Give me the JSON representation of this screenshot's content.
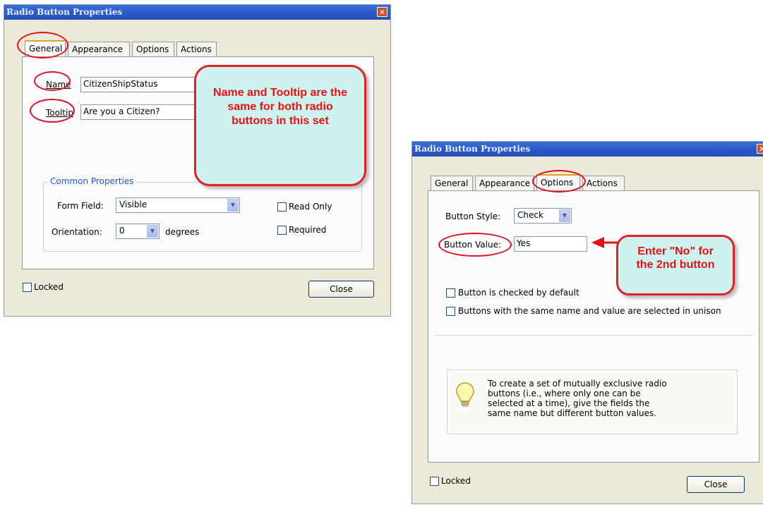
{
  "dialog1": {
    "title": "Radio Button Properties",
    "tabs": [
      "General",
      "Appearance",
      "Options",
      "Actions"
    ],
    "name_label": "Name",
    "name_value": "CitizenShipStatus",
    "tooltip_label": "Tooltip",
    "tooltip_value": "Are you a Citizen?",
    "group_title": "Common Properties",
    "form_field_label": "Form Field:",
    "form_field_value": "Visible",
    "orientation_label": "Orientation:",
    "orientation_value": "0",
    "degrees_label": "degrees",
    "read_only_label": "Read Only",
    "required_label": "Required",
    "locked_label": "Locked",
    "close_label": "Close",
    "callout_text": "Name and Tooltip are the same for both radio buttons in this set"
  },
  "dialog2": {
    "title": "Radio Button Properties",
    "tabs": [
      "General",
      "Appearance",
      "Options",
      "Actions"
    ],
    "button_style_label": "Button Style:",
    "button_style_value": "Check",
    "button_value_label": "Button Value:",
    "button_value_value": "Yes",
    "checked_default_label": "Button is checked by default",
    "unison_label": "Buttons with the same name and value are selected in unison",
    "tip_text": "To create a set of mutually exclusive radio buttons (i.e., where only one can be selected at a time), give the fields the same name but different button values.",
    "locked_label": "Locked",
    "close_label": "Close",
    "callout_text": "Enter \"No\" for the 2nd button"
  },
  "colors": {
    "callout_fill": "#cdf3f0",
    "callout_text": "#e81010",
    "highlight_ring": "#e01020"
  }
}
